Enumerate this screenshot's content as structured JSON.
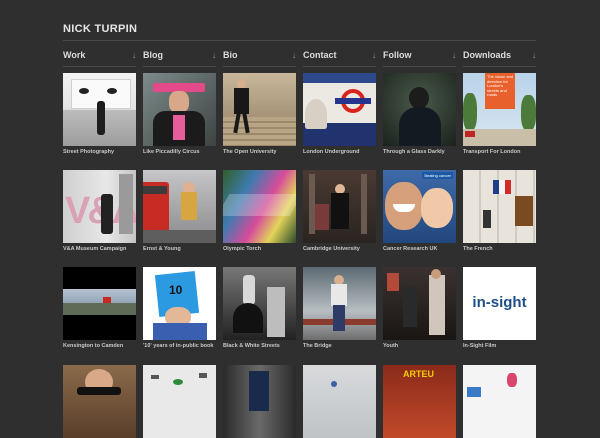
{
  "site": {
    "title": "NICK TURPIN"
  },
  "nav": [
    {
      "label": "Work",
      "caret": "↓"
    },
    {
      "label": "Blog",
      "caret": "↓"
    },
    {
      "label": "Bio",
      "caret": "↓"
    },
    {
      "label": "Contact",
      "caret": "↓"
    },
    {
      "label": "Follow",
      "caret": "↓"
    },
    {
      "label": "Downloads",
      "caret": "↓"
    }
  ],
  "tiles": [
    {
      "caption": "Street Photography"
    },
    {
      "caption": "Like Piccadilly Circus"
    },
    {
      "caption": "The Open University"
    },
    {
      "caption": "London Underground"
    },
    {
      "caption": "Through a Glass Darkly"
    },
    {
      "caption": "Transport For London"
    },
    {
      "caption": "V&A Museum Campaign"
    },
    {
      "caption": "Ernst & Young"
    },
    {
      "caption": "Olympic Torch"
    },
    {
      "caption": "Cambridge University"
    },
    {
      "caption": "Cancer Research UK"
    },
    {
      "caption": "The French"
    },
    {
      "caption": "Kensington to Camden"
    },
    {
      "caption": "'10' years of in-public book"
    },
    {
      "caption": "Black & White Streets"
    },
    {
      "caption": "The Bridge"
    },
    {
      "caption": "Youth"
    },
    {
      "caption": "In-Sight Film"
    }
  ],
  "artwork_text": {
    "tfl_poster": "The vision and direction for London's streets and roads",
    "cancer_research": "Beating cancer",
    "va_logo": "V&A",
    "in_public_book": "10",
    "insight_logo": "in-sight",
    "arteu_sign": "ARTEU"
  }
}
